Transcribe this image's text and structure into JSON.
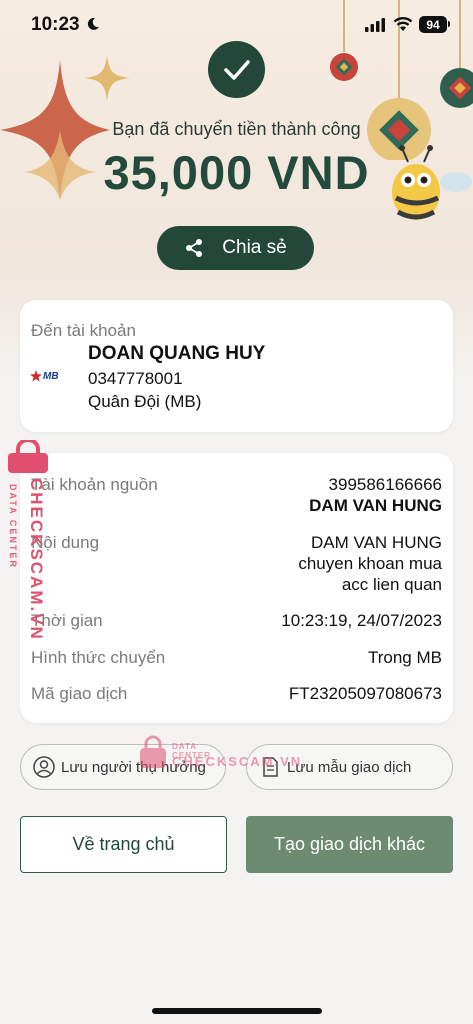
{
  "status_bar": {
    "time": "10:23",
    "battery": "94"
  },
  "result": {
    "success_text": "Bạn đã chuyển tiền thành công",
    "amount": "35,000 VND",
    "share_label": "Chia sẻ"
  },
  "destination": {
    "label": "Đến tài khoản",
    "bank_logo_text": "MB",
    "name": "DOAN QUANG HUY",
    "account": "0347778001",
    "bank": "Quân Đội (MB)"
  },
  "details": {
    "source_label": "Tài khoản nguồn",
    "source_account": "399586166666",
    "source_name": "DAM VAN HUNG",
    "content_label": "Nội dung",
    "content_lines": [
      "DAM VAN HUNG",
      "chuyen khoan mua",
      "acc lien quan"
    ],
    "time_label": "Thời gian",
    "time_value": "10:23:19, 24/07/2023",
    "method_label": "Hình thức chuyển",
    "method_value": "Trong MB",
    "code_label": "Mã giao dịch",
    "code_value": "FT23205097080673"
  },
  "actions": {
    "save_recipient": "Lưu người thụ hưởng",
    "save_template": "Lưu mẫu giao dịch",
    "home": "Về trang chủ",
    "new_transaction": "Tạo giao dịch khác"
  },
  "watermark": {
    "brand": "CHECKSCAM.VN",
    "sub": "DATA CENTER",
    "center_brand": "CHECKSCAM.VN"
  },
  "colors": {
    "primary": "#23483a",
    "secondary_button": "#6d8b70",
    "watermark": "#e0506e"
  }
}
